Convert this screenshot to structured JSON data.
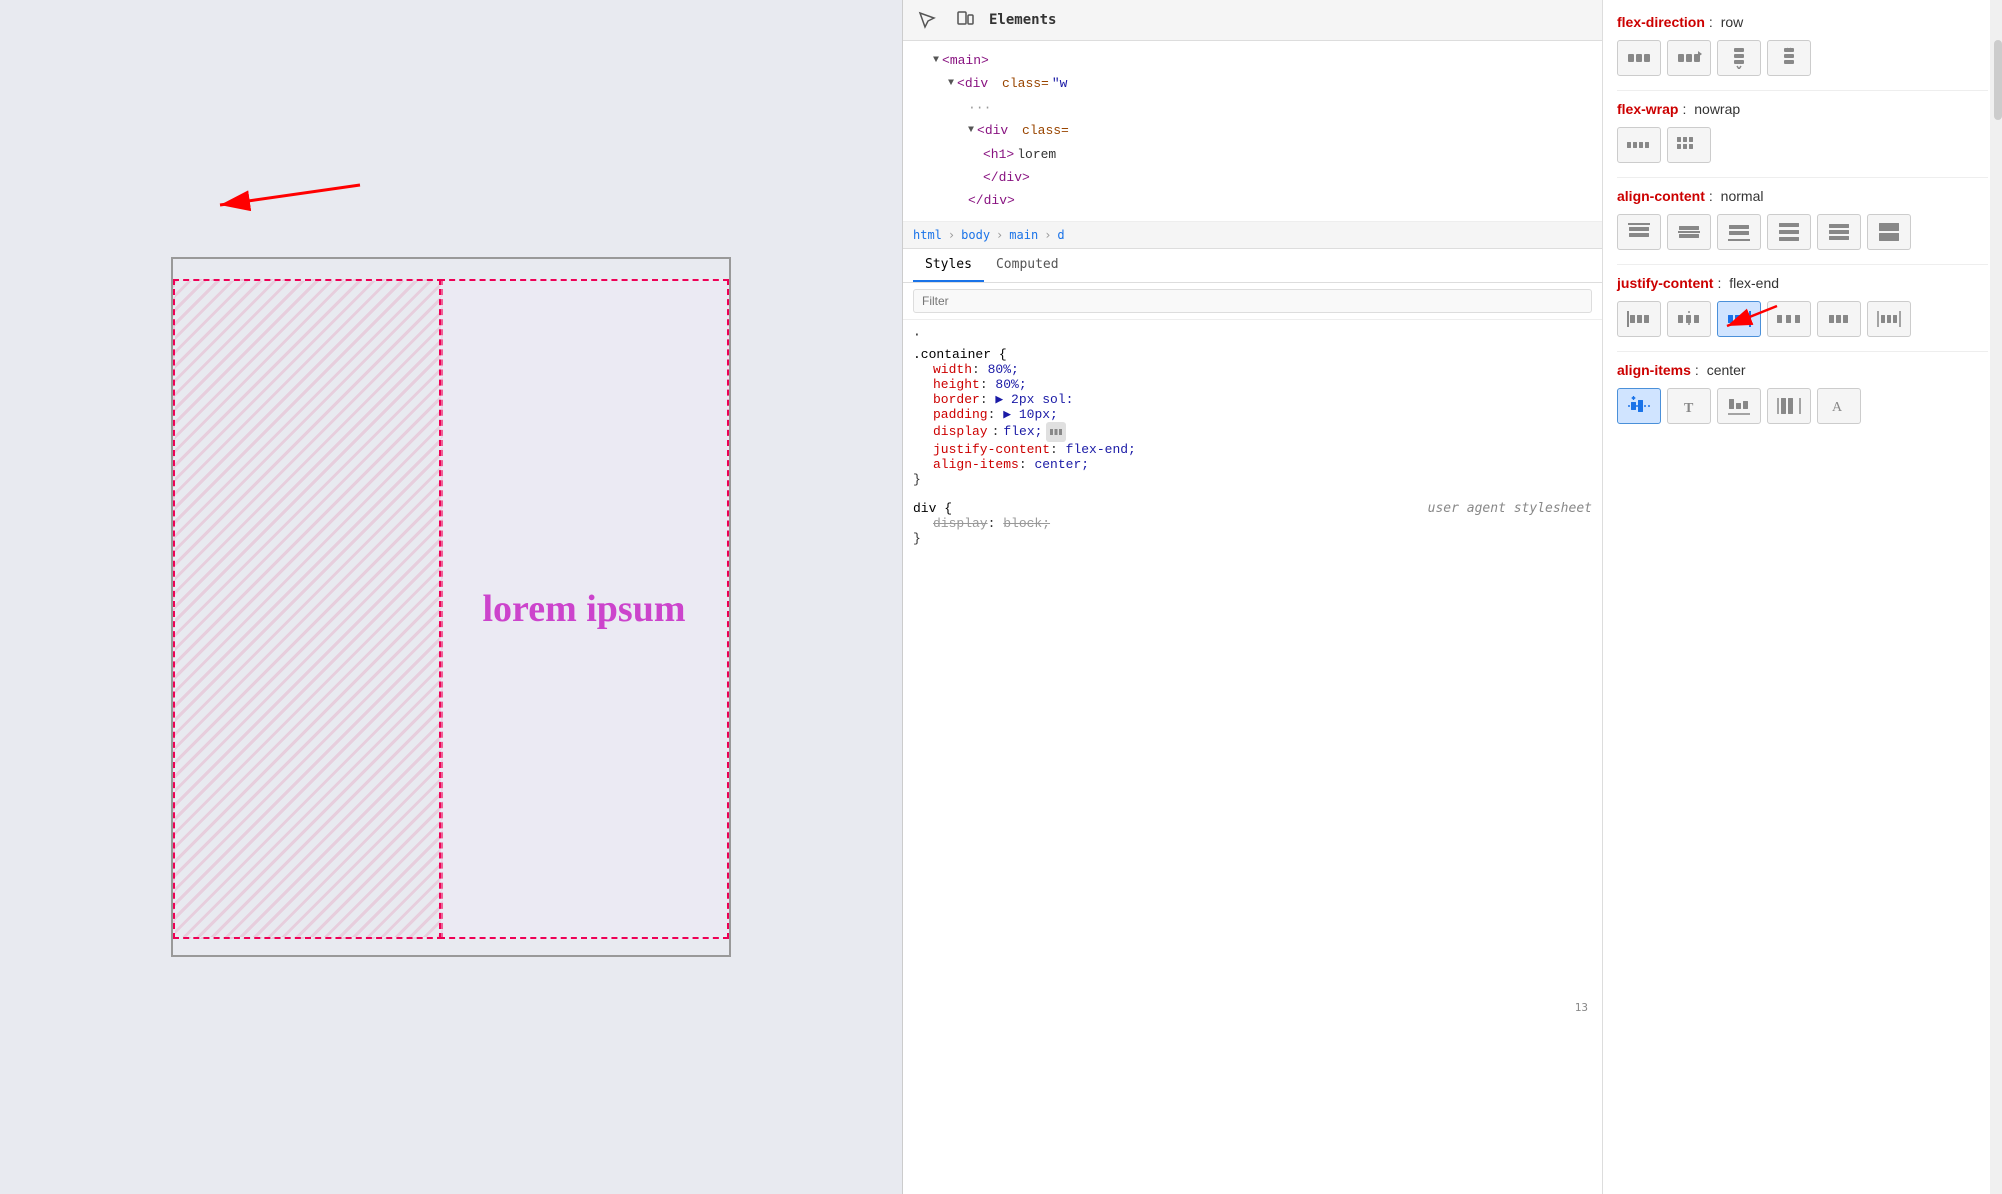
{
  "preview": {
    "lorem_text": "lorem ipsum"
  },
  "devtools": {
    "toolbar": {
      "inspect_icon": "⊡",
      "device_icon": "📱"
    },
    "tabs": [
      {
        "label": "Elements",
        "active": true
      }
    ],
    "dom": {
      "lines": [
        {
          "indent": 1,
          "content": "▼ <main>",
          "tag": "main"
        },
        {
          "indent": 2,
          "content": "▼ <div class=\"w",
          "tag": "div",
          "class": "w"
        },
        {
          "indent": 3,
          "dots": "···"
        },
        {
          "indent": 3,
          "content": "▼ <div class=",
          "tag": "div"
        },
        {
          "indent": 4,
          "content": "<h1>lorem",
          "tag": "h1"
        },
        {
          "indent": 4,
          "content": "</div>",
          "closing": true
        },
        {
          "indent": 3,
          "content": "</div>",
          "closing": true
        }
      ]
    },
    "breadcrumb": {
      "items": [
        "html",
        "body",
        "main",
        "d"
      ]
    },
    "style_tabs": [
      {
        "label": "Styles",
        "active": true
      },
      {
        "label": "Computed",
        "active": false
      }
    ],
    "filter_placeholder": "Filter",
    "css_rules": [
      {
        "selector": ".container {",
        "properties": [
          {
            "name": "width",
            "value": "80%",
            "strikethrough": false
          },
          {
            "name": "height",
            "value": "80%",
            "strikethrough": false
          },
          {
            "name": "border",
            "value": "▶ 2px sol:",
            "strikethrough": false
          },
          {
            "name": "padding",
            "value": "▶ 10px;",
            "strikethrough": false
          },
          {
            "name": "display",
            "value": "flex;",
            "strikethrough": false
          },
          {
            "name": "justify-content",
            "value": "flex-end;",
            "strikethrough": false
          },
          {
            "name": "align-items",
            "value": "center;",
            "strikethrough": false
          }
        ]
      },
      {
        "selector": "div {",
        "user_agent": true,
        "user_agent_label": "user agent stylesheet",
        "properties": [
          {
            "name": "display",
            "value": "block;",
            "strikethrough": true
          }
        ]
      }
    ]
  },
  "flex_inspector": {
    "flex_direction": {
      "label": "flex-direction",
      "value": "row",
      "buttons": [
        {
          "icon": "⬛⬛",
          "label": "row",
          "active": false,
          "title": "row"
        },
        {
          "icon": "⬛⬛↓",
          "label": "row-reverse",
          "active": false,
          "title": "row-reverse"
        },
        {
          "icon": "⬛⬛|",
          "label": "column",
          "active": false,
          "title": "column"
        },
        {
          "icon": "↑⬛⬛",
          "label": "column-reverse",
          "active": false,
          "title": "column-reverse"
        }
      ]
    },
    "flex_wrap": {
      "label": "flex-wrap",
      "value": "nowrap",
      "buttons": [
        {
          "icon": "|||",
          "label": "nowrap",
          "active": false
        },
        {
          "icon": "⠿⠿",
          "label": "wrap",
          "active": false
        }
      ]
    },
    "align_content": {
      "label": "align-content",
      "value": "normal",
      "buttons": [
        {
          "icon": "≡",
          "label": "start",
          "active": false
        },
        {
          "icon": "≡",
          "label": "center",
          "active": false
        },
        {
          "icon": "≡",
          "label": "end",
          "active": false
        },
        {
          "icon": "≡",
          "label": "space-between",
          "active": false
        },
        {
          "icon": "≡",
          "label": "space-around",
          "active": false
        },
        {
          "icon": "≡",
          "label": "stretch",
          "active": false
        }
      ]
    },
    "justify_content": {
      "label": "justify-content",
      "value": "flex-end",
      "buttons": [
        {
          "icon": "⦸|",
          "label": "flex-start",
          "active": false
        },
        {
          "icon": "|⦸",
          "label": "center",
          "active": false
        },
        {
          "icon": "⦸⦸",
          "label": "flex-end",
          "active": true
        },
        {
          "icon": "⦿⦿",
          "label": "space-between",
          "active": false
        },
        {
          "icon": "⦿⦿|",
          "label": "space-around",
          "active": false
        },
        {
          "icon": "|⦿⦿|",
          "label": "space-evenly",
          "active": false
        }
      ]
    },
    "align_items": {
      "label": "align-items",
      "value": "center",
      "buttons": [
        {
          "icon": "✛",
          "label": "center",
          "active": true
        },
        {
          "icon": "T",
          "label": "start",
          "active": false
        },
        {
          "icon": "⏤",
          "label": "end",
          "active": false
        },
        {
          "icon": "||",
          "label": "stretch",
          "active": false
        },
        {
          "icon": "A",
          "label": "baseline",
          "active": false
        }
      ]
    }
  }
}
